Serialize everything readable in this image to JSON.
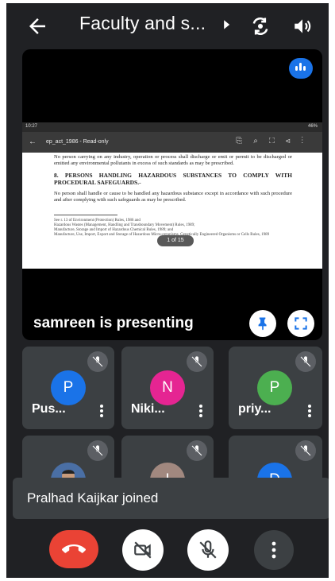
{
  "header": {
    "title": "Faculty and s...",
    "icons": [
      "back-arrow-icon",
      "caret-right-icon",
      "switch-camera-icon",
      "speaker-icon"
    ]
  },
  "presentation": {
    "status_left": "10:27",
    "status_right": "46%",
    "file_name": "ep_act_1986 - Read-only",
    "body_text_1": "No person carrying on any industry, operation or process shall discharge or emit or permit to be discharged or emitted any environmental pollutants in excess of such standards as may be prescribed.",
    "heading": "8. PERSONS HANDLING HAZARDOUS SUBSTANCES TO COMPLY WITH PROCEDURAL SAFEGUARDS.-",
    "body_text_2": "No person shall handle or cause to be handled any hazardous substance except in accordance with such procedure and after complying with such safeguards as may be prescribed.",
    "footnotes": [
      "See r. 13 of Environment (Protection) Rules, 1986 and",
      "Hazardous Wastes (Management, Handling and Transboundary Movement) Rules, 1989;",
      "Manufacture, Storage and Import of Hazardous Chemical Rules, 1989; and",
      "Manufacture, Use, Import, Export and Storage of Hazardous Micro-organisms, Genetically Engineered Organisms or Cells Rules, 1989"
    ],
    "page_indicator": "1 of 15",
    "presenting_label": "samreen is presenting"
  },
  "participants": [
    {
      "name": "Pus...",
      "initial": "P",
      "color": "#1a73e8",
      "muted": true
    },
    {
      "name": "Niki...",
      "initial": "N",
      "color": "#e52592",
      "muted": true
    },
    {
      "name": "priy...",
      "initial": "P",
      "color": "#4caf50",
      "muted": true
    },
    {
      "name": "",
      "initial": "",
      "color": "#4a6fa5",
      "muted": true
    },
    {
      "name": "",
      "initial": "I",
      "color": "#a1887f",
      "muted": true
    },
    {
      "name": "",
      "initial": "D",
      "color": "#1a73e8",
      "muted": true
    }
  ],
  "toast": {
    "message": "Pralhad Kaijkar joined"
  },
  "controls": {
    "hangup_color": "#ea4335",
    "icons": [
      "end-call-icon",
      "camera-off-icon",
      "mic-off-icon",
      "more-vert-icon"
    ]
  }
}
